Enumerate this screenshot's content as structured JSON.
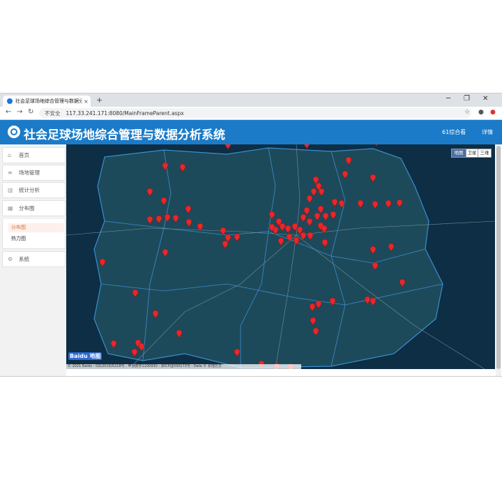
{
  "browser": {
    "tab_title": "社会足球场地综合管理与数据分析系统",
    "close_icon": "×",
    "new_tab_icon": "+",
    "security_label": "不安全",
    "url": "117.33.241.171:8080/MainFrameParent.aspx"
  },
  "header": {
    "title": "社会足球场地综合管理与数据分析系统",
    "badge": "61综合看",
    "detail_link": "详情"
  },
  "sidebar": {
    "items": [
      {
        "label": "首页",
        "icon": "home-icon"
      },
      {
        "label": "场地管理",
        "icon": "list-icon"
      },
      {
        "label": "统计分析",
        "icon": "bar-chart-icon"
      },
      {
        "label": "分布图",
        "icon": "map-icon"
      }
    ],
    "subitems": [
      {
        "label": "分布图",
        "active": true
      },
      {
        "label": "热力图",
        "active": false
      }
    ],
    "settings_label": "系统"
  },
  "map": {
    "type_options": [
      "地图",
      "卫星",
      "三维"
    ],
    "selected_type": "地图",
    "logo_text": "Baidu 地图",
    "copyright": "© 2021 Baidu - GS(2019)5218号 - 甲测资字1100930 - 京ICP证030173号 - Data © 长地万方",
    "marker_color": "#e8272b"
  }
}
